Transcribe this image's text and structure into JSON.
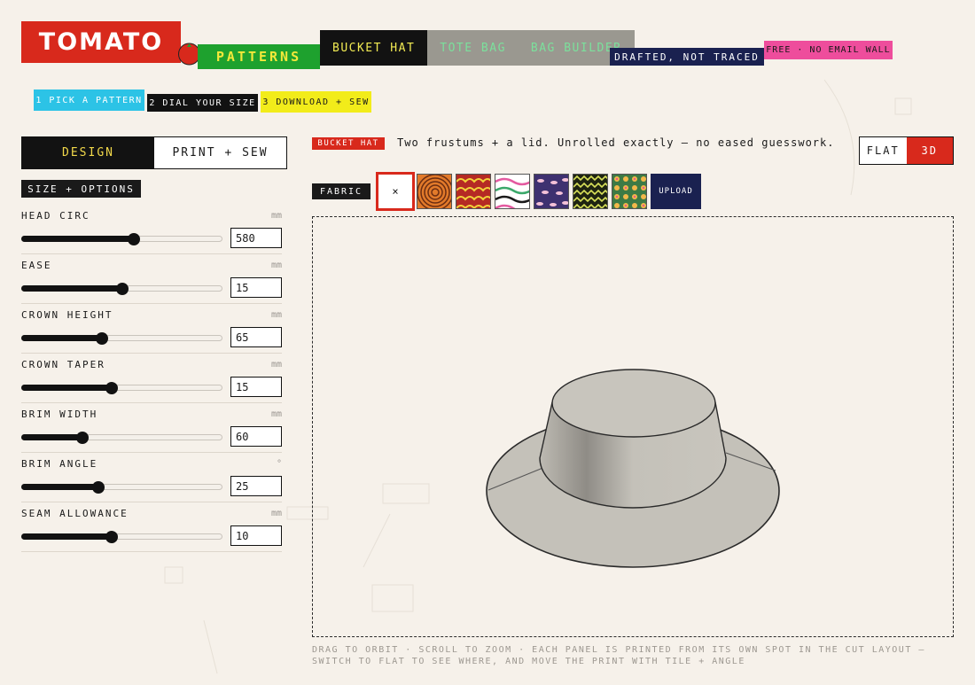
{
  "brand": {
    "name": "TOMATO",
    "sub": "PATTERNS"
  },
  "nav": {
    "items": [
      "BUCKET HAT",
      "TOTE BAG",
      "BAG BUILDER"
    ],
    "active": 0
  },
  "tags": {
    "drafted": "DRAFTED, NOT TRACED",
    "free": "FREE · NO EMAIL WALL"
  },
  "steps": [
    "1 PICK A PATTERN",
    "2 DIAL YOUR SIZE",
    "3 DOWNLOAD + SEW"
  ],
  "left_tabs": [
    "DESIGN",
    "PRINT + SEW"
  ],
  "section_title": "SIZE + OPTIONS",
  "params": [
    {
      "label": "HEAD CIRC",
      "unit": "mm",
      "value": "580",
      "level": 0.56
    },
    {
      "label": "EASE",
      "unit": "mm",
      "value": "15",
      "level": 0.5
    },
    {
      "label": "CROWN HEIGHT",
      "unit": "mm",
      "value": "65",
      "level": 0.4
    },
    {
      "label": "CROWN TAPER",
      "unit": "mm",
      "value": "15",
      "level": 0.45
    },
    {
      "label": "BRIM WIDTH",
      "unit": "mm",
      "value": "60",
      "level": 0.3
    },
    {
      "label": "BRIM ANGLE",
      "unit": "°",
      "value": "25",
      "level": 0.38
    },
    {
      "label": "SEAM ALLOWANCE",
      "unit": "mm",
      "value": "10",
      "level": 0.45
    }
  ],
  "pattern_badge": "BUCKET HAT",
  "description": "Two frustums + a lid. Unrolled exactly — no eased guesswork.",
  "view_toggle": [
    "FLAT",
    "3D"
  ],
  "fabric_label": "FABRIC",
  "fabric_none": "×",
  "fabric_swatches": [
    {
      "name": "orange-rings",
      "colors": [
        "#e27a2a",
        "#6b2d12"
      ]
    },
    {
      "name": "red-scallops",
      "colors": [
        "#b52a24",
        "#f2d33a"
      ]
    },
    {
      "name": "pastel-zigzag",
      "colors": [
        "#ffffff",
        "#e45aa0"
      ]
    },
    {
      "name": "purple-lips",
      "colors": [
        "#3e3170",
        "#f4c2d8"
      ]
    },
    {
      "name": "olive-zigzag",
      "colors": [
        "#1f2412",
        "#d8e05a"
      ]
    },
    {
      "name": "green-flowers",
      "colors": [
        "#3d7a45",
        "#f3b84a"
      ]
    }
  ],
  "upload_label": "UPLOAD",
  "hint": "DRAG TO ORBIT · SCROLL TO ZOOM · EACH PANEL IS PRINTED FROM ITS OWN SPOT IN THE CUT LAYOUT — SWITCH TO FLAT TO SEE WHERE, AND MOVE THE PRINT WITH TILE + ANGLE",
  "colors": {
    "brand_red": "#d8291c",
    "brand_green": "#1ea12e",
    "navy": "#1a2150",
    "pink": "#ee4d9c",
    "cyan": "#2cc3e6",
    "yellow": "#f2ec1a"
  }
}
